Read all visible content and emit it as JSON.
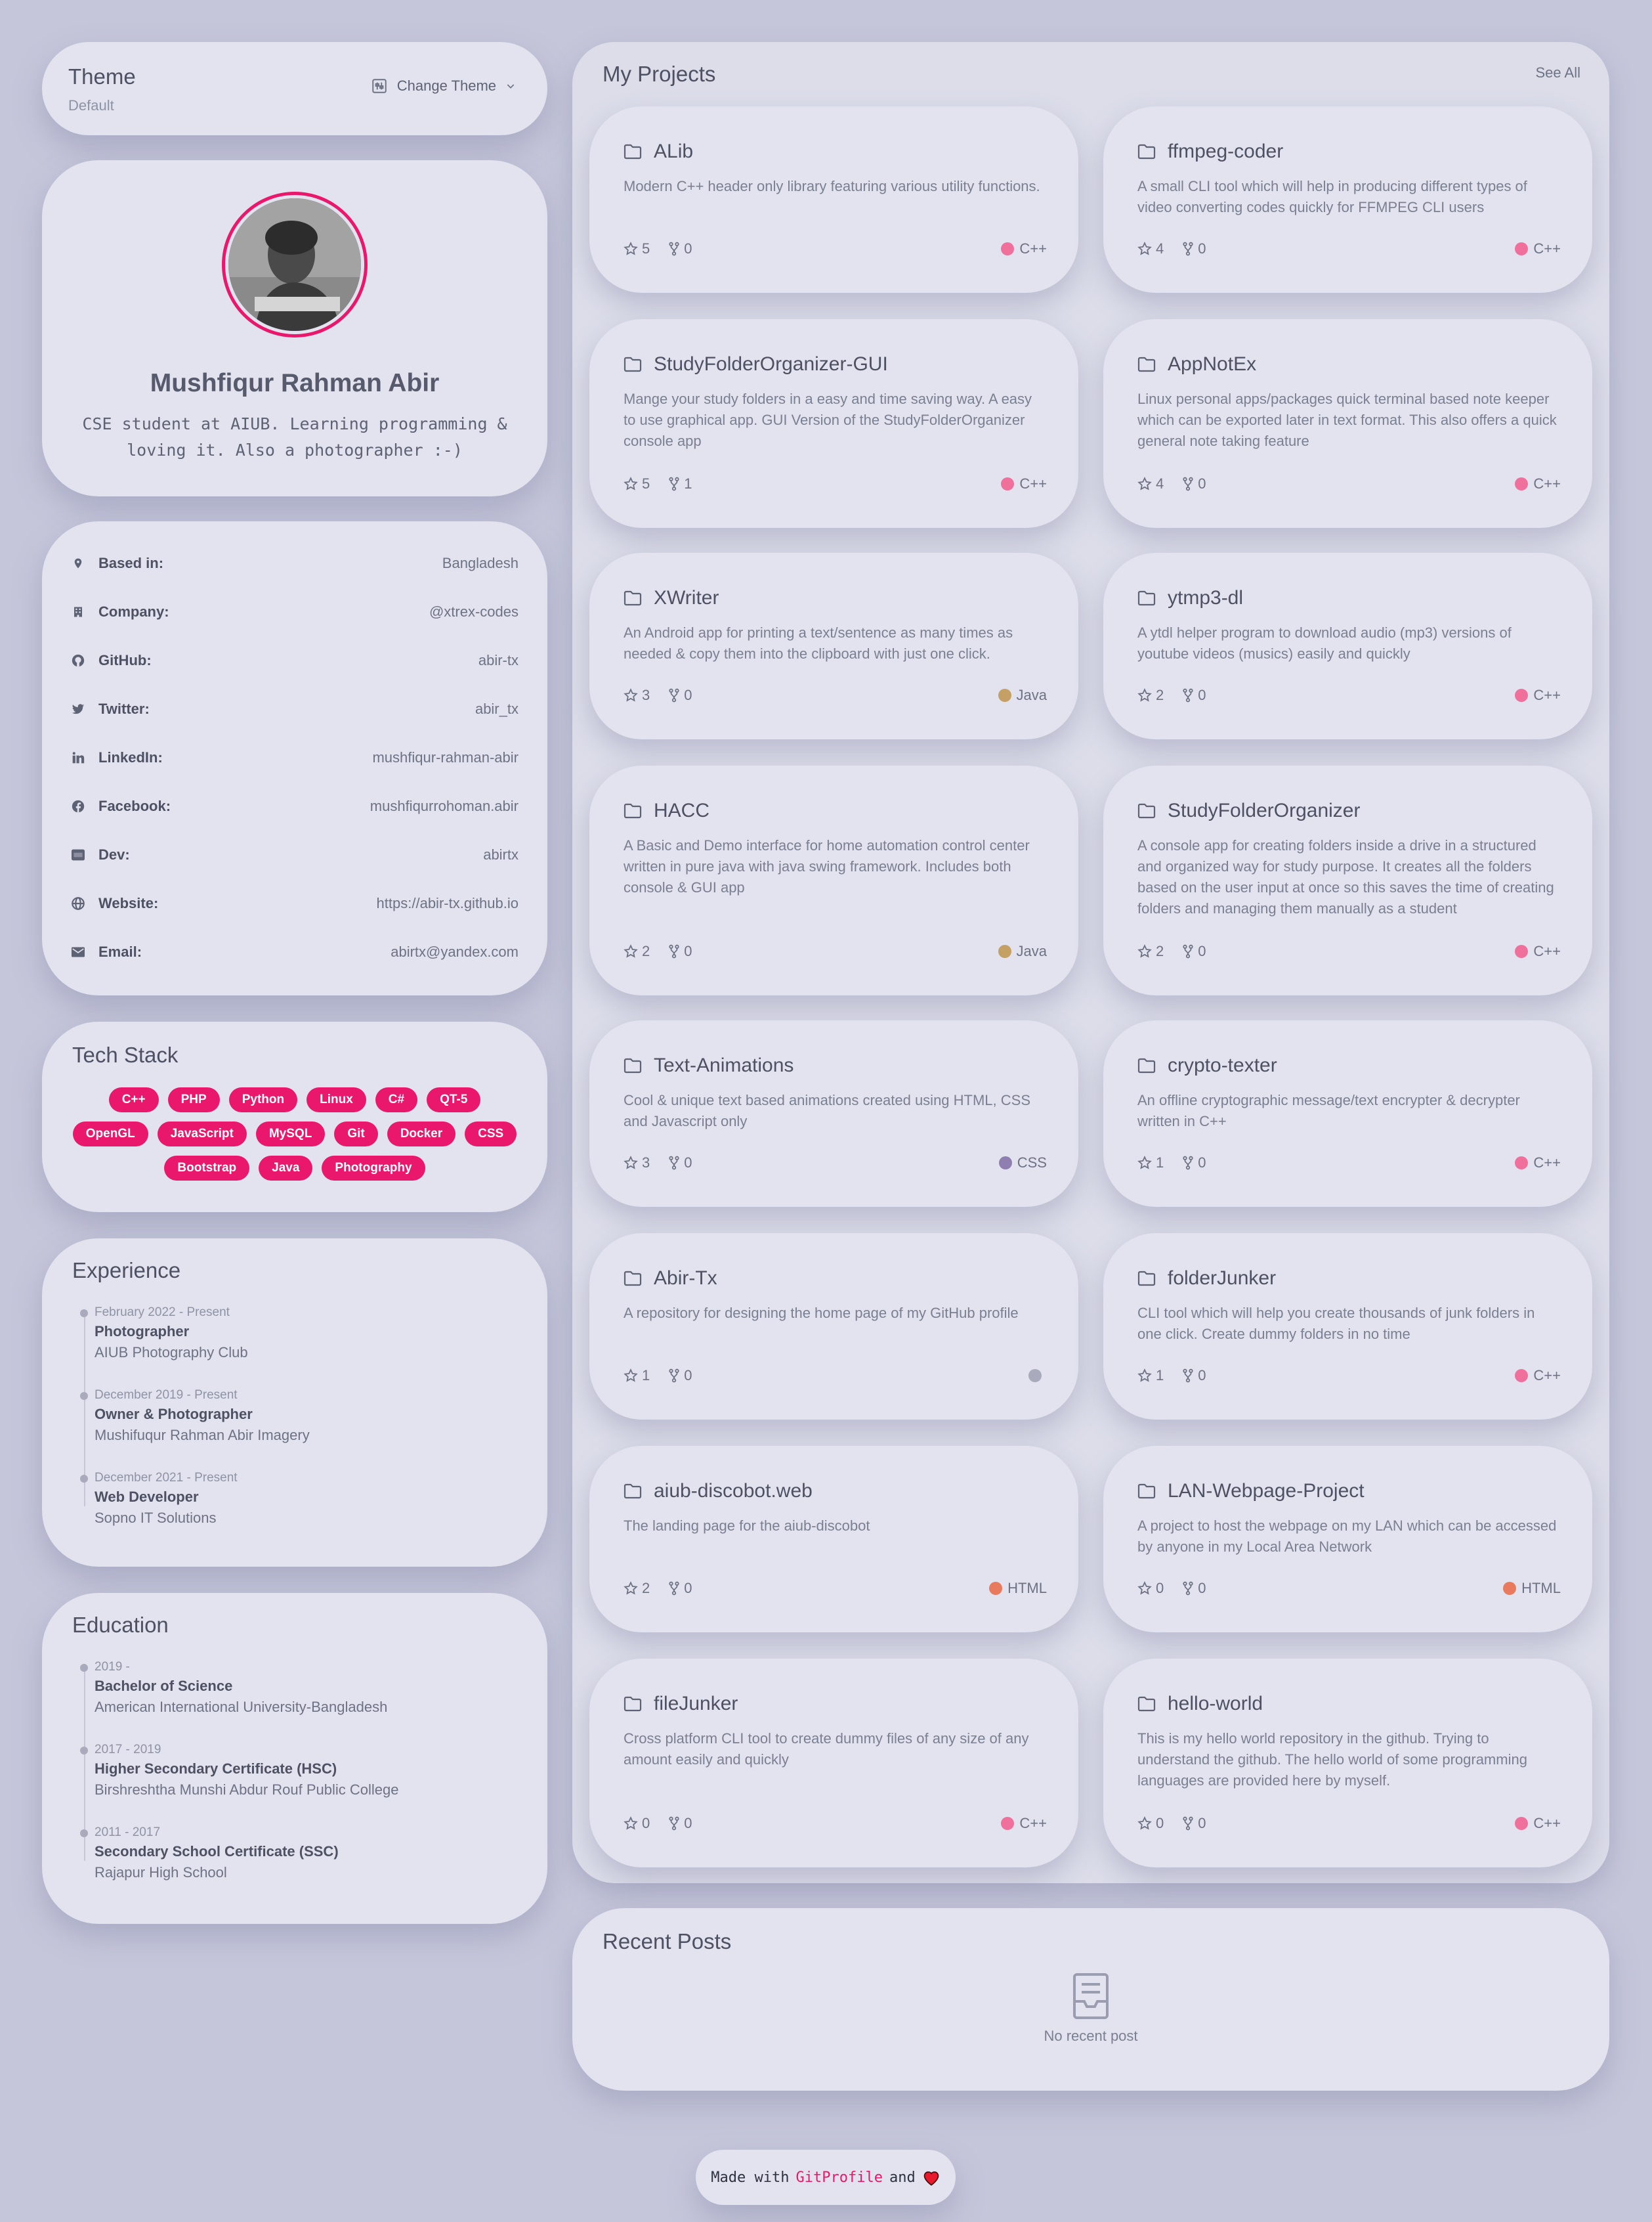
{
  "theme": {
    "title": "Theme",
    "current": "Default",
    "button_label": "Change Theme"
  },
  "profile": {
    "name": "Mushfiqur Rahman Abir",
    "bio": "CSE student at AIUB. Learning programming & loving it. Also a photographer :-)"
  },
  "details": [
    {
      "icon": "location-pin-icon",
      "label": "Based in:",
      "value": "Bangladesh"
    },
    {
      "icon": "building-icon",
      "label": "Company:",
      "value": "@xtrex-codes"
    },
    {
      "icon": "github-icon",
      "label": "GitHub:",
      "value": "abir-tx"
    },
    {
      "icon": "twitter-icon",
      "label": "Twitter:",
      "value": "abir_tx"
    },
    {
      "icon": "linkedin-icon",
      "label": "LinkedIn:",
      "value": "mushfiqur-rahman-abir"
    },
    {
      "icon": "facebook-icon",
      "label": "Facebook:",
      "value": "mushfiqurrohoman.abir"
    },
    {
      "icon": "dev-icon",
      "label": "Dev:",
      "value": "abirtx"
    },
    {
      "icon": "globe-icon",
      "label": "Website:",
      "value": "https://abir-tx.github.io"
    },
    {
      "icon": "envelope-icon",
      "label": "Email:",
      "value": "abirtx@yandex.com"
    }
  ],
  "tech_stack": {
    "title": "Tech Stack",
    "items": [
      "C++",
      "PHP",
      "Python",
      "Linux",
      "C#",
      "QT-5",
      "OpenGL",
      "JavaScript",
      "MySQL",
      "Git",
      "Docker",
      "CSS",
      "Bootstrap",
      "Java",
      "Photography"
    ]
  },
  "experience": {
    "title": "Experience",
    "items": [
      {
        "date": "February 2022 - Present",
        "role": "Photographer",
        "org": "AIUB Photography Club"
      },
      {
        "date": "December 2019 - Present",
        "role": "Owner & Photographer",
        "org": "Mushifuqur Rahman Abir Imagery"
      },
      {
        "date": "December 2021 - Present",
        "role": "Web Developer",
        "org": "Sopno IT Solutions"
      }
    ]
  },
  "education": {
    "title": "Education",
    "items": [
      {
        "date": "2019 -",
        "role": "Bachelor of Science",
        "org": "American International University-Bangladesh"
      },
      {
        "date": "2017 - 2019",
        "role": "Higher Secondary Certificate (HSC)",
        "org": "Birshreshtha Munshi Abdur Rouf Public College"
      },
      {
        "date": "2011 - 2017",
        "role": "Secondary School Certificate (SSC)",
        "org": "Rajapur High School"
      }
    ]
  },
  "projects": {
    "title": "My Projects",
    "see_all": "See All",
    "items": [
      {
        "name": "ALib",
        "desc": "Modern C++ header only library featuring various utility functions.",
        "stars": "5",
        "forks": "0",
        "lang": "C++",
        "color": "#f0709c"
      },
      {
        "name": "ffmpeg-coder",
        "desc": "A small CLI tool which will help in producing different types of video converting codes quickly for FFMPEG CLI users",
        "stars": "4",
        "forks": "0",
        "lang": "C++",
        "color": "#f0709c"
      },
      {
        "name": "StudyFolderOrganizer-GUI",
        "desc": "Mange your study folders in a easy and time saving way. A easy to use graphical app. GUI Version of the StudyFolderOrganizer console app",
        "stars": "5",
        "forks": "1",
        "lang": "C++",
        "color": "#f0709c"
      },
      {
        "name": "AppNotEx",
        "desc": "Linux personal apps/packages quick terminal based note keeper which can be exported later in text format. This also offers a quick general note taking feature",
        "stars": "4",
        "forks": "0",
        "lang": "C++",
        "color": "#f0709c"
      },
      {
        "name": "XWriter",
        "desc": "An Android app for printing a text/sentence as many times as needed & copy them into the clipboard with just one click.",
        "stars": "3",
        "forks": "0",
        "lang": "Java",
        "color": "#c4a064"
      },
      {
        "name": "ytmp3-dl",
        "desc": "A ytdl helper program to download audio (mp3) versions of youtube videos (musics) easily and quickly",
        "stars": "2",
        "forks": "0",
        "lang": "C++",
        "color": "#f0709c"
      },
      {
        "name": "HACC",
        "desc": "A Basic and Demo interface for home automation control center written in pure java with java swing framework. Includes both console & GUI app",
        "stars": "2",
        "forks": "0",
        "lang": "Java",
        "color": "#c4a064"
      },
      {
        "name": "StudyFolderOrganizer",
        "desc": "A console app for creating folders inside a drive in a structured and organized way for study purpose. It creates all the folders based on the user input at once so this saves the time of creating folders and managing them manually as a student",
        "stars": "2",
        "forks": "0",
        "lang": "C++",
        "color": "#f0709c"
      },
      {
        "name": "Text-Animations",
        "desc": "Cool & unique text based animations created using HTML, CSS and Javascript only",
        "stars": "3",
        "forks": "0",
        "lang": "CSS",
        "color": "#8e7fb0"
      },
      {
        "name": "crypto-texter",
        "desc": "An offline cryptographic message/text encrypter & decrypter written in C++",
        "stars": "1",
        "forks": "0",
        "lang": "C++",
        "color": "#f0709c"
      },
      {
        "name": "Abir-Tx",
        "desc": "A repository for designing the home page of my GitHub profile",
        "stars": "1",
        "forks": "0",
        "lang": "",
        "color": "#a9abbd"
      },
      {
        "name": "folderJunker",
        "desc": "CLI tool which will help you create thousands of junk folders in one click. Create dummy folders in no time",
        "stars": "1",
        "forks": "0",
        "lang": "C++",
        "color": "#f0709c"
      },
      {
        "name": "aiub-discobot.web",
        "desc": "The landing page for the aiub-discobot",
        "stars": "2",
        "forks": "0",
        "lang": "HTML",
        "color": "#e87a5d"
      },
      {
        "name": "LAN-Webpage-Project",
        "desc": "A project to host the webpage on my LAN which can be accessed by anyone in my Local Area Network",
        "stars": "0",
        "forks": "0",
        "lang": "HTML",
        "color": "#e87a5d"
      },
      {
        "name": "fileJunker",
        "desc": "Cross platform CLI tool to create dummy files of any size of any amount easily and quickly",
        "stars": "0",
        "forks": "0",
        "lang": "C++",
        "color": "#f0709c"
      },
      {
        "name": "hello-world",
        "desc": "This is my hello world repository in the github. Trying to understand the github. The hello world of some programming languages are provided here by myself.",
        "stars": "0",
        "forks": "0",
        "lang": "C++",
        "color": "#f0709c"
      }
    ]
  },
  "posts": {
    "title": "Recent Posts",
    "empty": "No recent post"
  },
  "footer": {
    "made_with": "Made with",
    "brand": "GitProfile",
    "and": "and"
  },
  "colors": {
    "accent": "#e9186c",
    "background": "#c5c6da",
    "card": "#e2e3ee"
  }
}
